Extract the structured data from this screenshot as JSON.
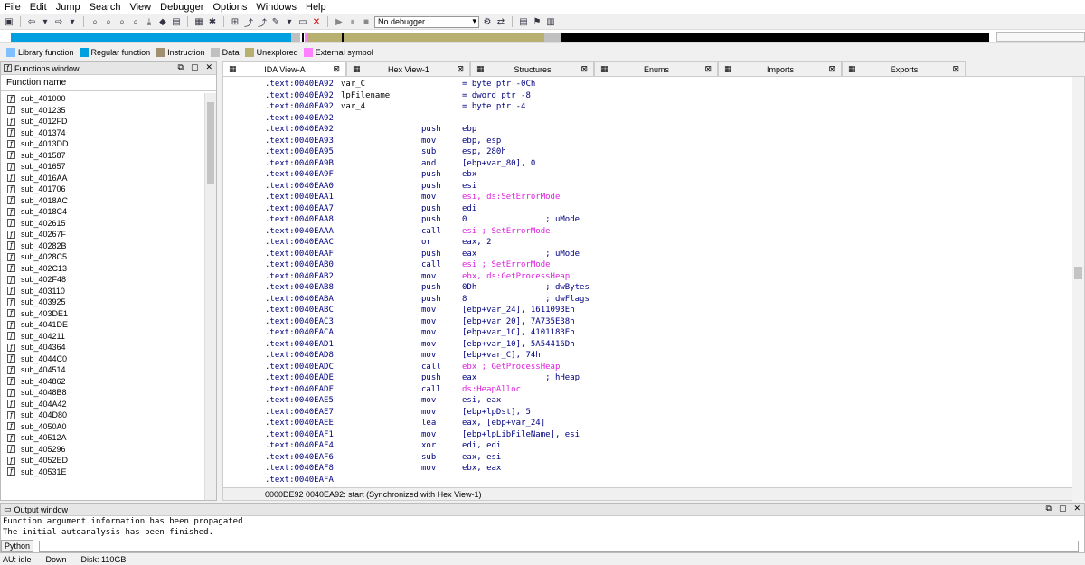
{
  "menu": [
    "File",
    "Edit",
    "Jump",
    "Search",
    "View",
    "Debugger",
    "Options",
    "Windows",
    "Help"
  ],
  "toolbar": {
    "debugger_select": "No debugger"
  },
  "legend": [
    {
      "label": "Library function",
      "color": "#80c0ff"
    },
    {
      "label": "Regular function",
      "color": "#00a0e0"
    },
    {
      "label": "Instruction",
      "color": "#a09070"
    },
    {
      "label": "Data",
      "color": "#c0c0c0"
    },
    {
      "label": "Unexplored",
      "color": "#b8b070"
    },
    {
      "label": "External symbol",
      "color": "#ff80ff"
    }
  ],
  "functions_window": {
    "title": "Functions window",
    "column": "Function name",
    "items": [
      "sub_401000",
      "sub_401235",
      "sub_4012FD",
      "sub_401374",
      "sub_4013DD",
      "sub_401587",
      "sub_401657",
      "sub_4016AA",
      "sub_401706",
      "sub_4018AC",
      "sub_4018C4",
      "sub_402615",
      "sub_40267F",
      "sub_40282B",
      "sub_4028C5",
      "sub_402C13",
      "sub_402F48",
      "sub_403110",
      "sub_403925",
      "sub_403DE1",
      "sub_4041DE",
      "sub_404211",
      "sub_404364",
      "sub_4044C0",
      "sub_404514",
      "sub_404862",
      "sub_4048B8",
      "sub_404A42",
      "sub_404D80",
      "sub_4050A0",
      "sub_40512A",
      "sub_405296",
      "sub_4052ED",
      "sub_40531E"
    ]
  },
  "tabs": [
    {
      "label": "IDA View-A",
      "active": true
    },
    {
      "label": "Hex View-1",
      "active": false
    },
    {
      "label": "Structures",
      "active": false
    },
    {
      "label": "Enums",
      "active": false
    },
    {
      "label": "Imports",
      "active": false
    },
    {
      "label": "Exports",
      "active": false
    }
  ],
  "listing": [
    {
      "addr": ".text:0040EA92",
      "label": "var_C",
      "mn": "",
      "op": "= byte ptr -0Ch"
    },
    {
      "addr": ".text:0040EA92",
      "label": "lpFilename",
      "mn": "",
      "op": "= dword ptr -8"
    },
    {
      "addr": ".text:0040EA92",
      "label": "var_4",
      "mn": "",
      "op": "= byte ptr -4"
    },
    {
      "addr": ".text:0040EA92",
      "label": "",
      "mn": "",
      "op": ""
    },
    {
      "addr": ".text:0040EA92",
      "label": "",
      "mn": "push",
      "op": "ebp"
    },
    {
      "addr": ".text:0040EA93",
      "label": "",
      "mn": "mov",
      "op": "ebp, esp"
    },
    {
      "addr": ".text:0040EA95",
      "label": "",
      "mn": "sub",
      "op": "esp, 280h"
    },
    {
      "addr": ".text:0040EA9B",
      "label": "",
      "mn": "and",
      "op": "[ebp+var_80], 0"
    },
    {
      "addr": ".text:0040EA9F",
      "label": "",
      "mn": "push",
      "op": "ebx"
    },
    {
      "addr": ".text:0040EAA0",
      "label": "",
      "mn": "push",
      "op": "esi"
    },
    {
      "addr": ".text:0040EAA1",
      "label": "",
      "mn": "mov",
      "op": "esi, ds:SetErrorMode"
    },
    {
      "addr": ".text:0040EAA7",
      "label": "",
      "mn": "push",
      "op": "edi"
    },
    {
      "addr": ".text:0040EAA8",
      "label": "",
      "mn": "push",
      "op": "0                ; uMode"
    },
    {
      "addr": ".text:0040EAAA",
      "label": "",
      "mn": "call",
      "op": "esi ; SetErrorMode"
    },
    {
      "addr": ".text:0040EAAC",
      "label": "",
      "mn": "or",
      "op": "eax, 2"
    },
    {
      "addr": ".text:0040EAAF",
      "label": "",
      "mn": "push",
      "op": "eax              ; uMode"
    },
    {
      "addr": ".text:0040EAB0",
      "label": "",
      "mn": "call",
      "op": "esi ; SetErrorMode"
    },
    {
      "addr": ".text:0040EAB2",
      "label": "",
      "mn": "mov",
      "op": "ebx, ds:GetProcessHeap"
    },
    {
      "addr": ".text:0040EAB8",
      "label": "",
      "mn": "push",
      "op": "0Dh              ; dwBytes"
    },
    {
      "addr": ".text:0040EABA",
      "label": "",
      "mn": "push",
      "op": "8                ; dwFlags"
    },
    {
      "addr": ".text:0040EABC",
      "label": "",
      "mn": "mov",
      "op": "[ebp+var_24], 1611093Eh"
    },
    {
      "addr": ".text:0040EAC3",
      "label": "",
      "mn": "mov",
      "op": "[ebp+var_20], 7A735E38h"
    },
    {
      "addr": ".text:0040EACA",
      "label": "",
      "mn": "mov",
      "op": "[ebp+var_1C], 4101183Eh"
    },
    {
      "addr": ".text:0040EAD1",
      "label": "",
      "mn": "mov",
      "op": "[ebp+var_10], 5A54416Dh"
    },
    {
      "addr": ".text:0040EAD8",
      "label": "",
      "mn": "mov",
      "op": "[ebp+var_C], 74h"
    },
    {
      "addr": ".text:0040EADC",
      "label": "",
      "mn": "call",
      "op": "ebx ; GetProcessHeap"
    },
    {
      "addr": ".text:0040EADE",
      "label": "",
      "mn": "push",
      "op": "eax              ; hHeap"
    },
    {
      "addr": ".text:0040EADF",
      "label": "",
      "mn": "call",
      "op": "ds:HeapAlloc"
    },
    {
      "addr": ".text:0040EAE5",
      "label": "",
      "mn": "mov",
      "op": "esi, eax"
    },
    {
      "addr": ".text:0040EAE7",
      "label": "",
      "mn": "mov",
      "op": "[ebp+lpDst], 5"
    },
    {
      "addr": ".text:0040EAEE",
      "label": "",
      "mn": "lea",
      "op": "eax, [ebp+var_24]"
    },
    {
      "addr": ".text:0040EAF1",
      "label": "",
      "mn": "mov",
      "op": "[ebp+lpLibFileName], esi"
    },
    {
      "addr": ".text:0040EAF4",
      "label": "",
      "mn": "xor",
      "op": "edi, edi"
    },
    {
      "addr": ".text:0040EAF6",
      "label": "",
      "mn": "sub",
      "op": "eax, esi"
    },
    {
      "addr": ".text:0040EAF8",
      "label": "",
      "mn": "mov",
      "op": "ebx, eax"
    },
    {
      "addr": ".text:0040EAFA",
      "label": "",
      "mn": "",
      "op": ""
    }
  ],
  "view_status": "0000DE92 0040EA92: start (Synchronized with Hex View-1)",
  "output_window": {
    "title": "Output window",
    "lines": [
      "Function argument information has been propagated",
      "The initial autoanalysis has been finished."
    ],
    "python_label": "Python"
  },
  "statusbar": [
    "AU:  idle",
    "Down",
    "Disk: 110GB"
  ]
}
